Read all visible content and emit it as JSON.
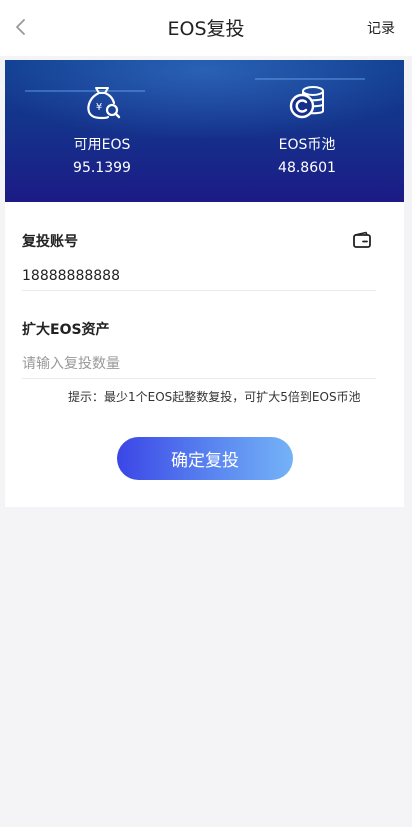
{
  "header": {
    "title": "EOS复投",
    "records_label": "记录"
  },
  "stats": {
    "available": {
      "label": "可用EOS",
      "value": "95.1399"
    },
    "pool": {
      "label": "EOS币池",
      "value": "48.8601"
    }
  },
  "form": {
    "account": {
      "label": "复投账号",
      "value": "18888888888"
    },
    "amount": {
      "label": "扩大EOS资产",
      "value": "",
      "placeholder": "请输入复投数量"
    },
    "hint": "提示：最少1个EOS起整数复投，可扩大5倍到EOS币池",
    "submit_label": "确定复投"
  },
  "colors": {
    "banner_top": "#0f3c8e",
    "banner_bottom": "#1c1a86",
    "button_start": "#3b46e6",
    "button_end": "#74b3f7",
    "page_background": "#f4f4f6"
  },
  "icons": {
    "back": "chevron-left-icon",
    "available": "money-bag-search-icon",
    "pool": "coin-stack-icon",
    "wallet": "wallet-icon"
  }
}
